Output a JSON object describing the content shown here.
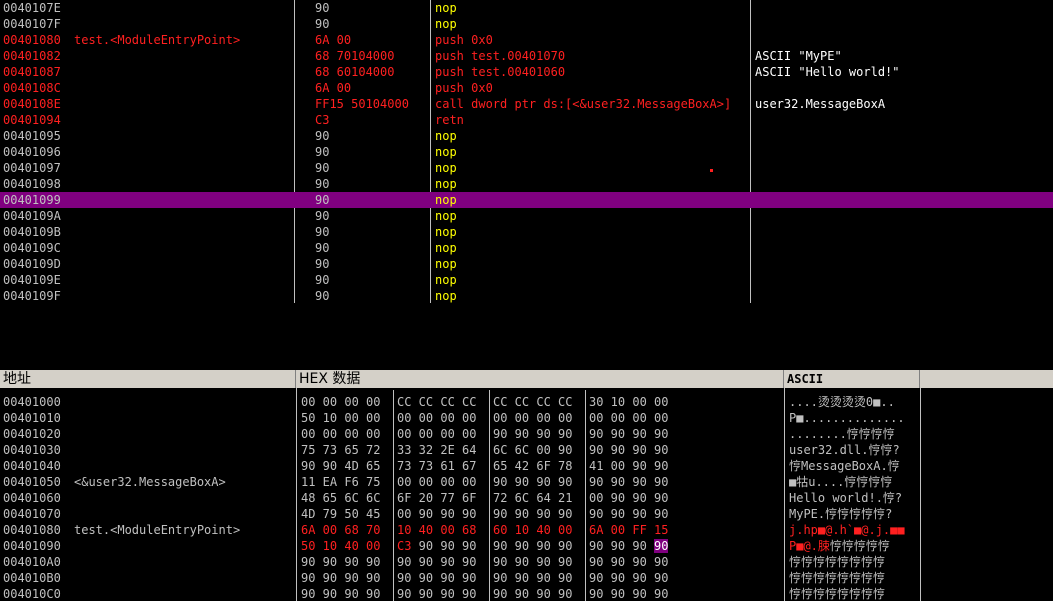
{
  "disassembly": {
    "rows": [
      {
        "addr": "0040107E",
        "label": "",
        "hex": "90",
        "asm": "nop",
        "comment": "",
        "style": "normal"
      },
      {
        "addr": "0040107F",
        "label": "",
        "hex": "90",
        "asm": "nop",
        "comment": "",
        "style": "normal"
      },
      {
        "addr": "00401080",
        "label": "test.<ModuleEntryPoint>",
        "hex": "6A 00",
        "asm": "push 0x0",
        "comment": "",
        "style": "code"
      },
      {
        "addr": "00401082",
        "label": "",
        "hex": "68 70104000",
        "asm": "push test.00401070",
        "comment": "ASCII \"MyPE\"",
        "style": "code"
      },
      {
        "addr": "00401087",
        "label": "",
        "hex": "68 60104000",
        "asm": "push test.00401060",
        "comment": "ASCII \"Hello world!\"",
        "style": "code"
      },
      {
        "addr": "0040108C",
        "label": "",
        "hex": "6A 00",
        "asm": "push 0x0",
        "comment": "",
        "style": "code"
      },
      {
        "addr": "0040108E",
        "label": "",
        "hex": "FF15 50104000",
        "asm": "call dword ptr ds:[<&user32.MessageBoxA>]",
        "comment": "user32.MessageBoxA",
        "style": "code"
      },
      {
        "addr": "00401094",
        "label": "",
        "hex": "C3",
        "asm": "retn",
        "comment": "",
        "style": "code"
      },
      {
        "addr": "00401095",
        "label": "",
        "hex": "90",
        "asm": "nop",
        "comment": "",
        "style": "normal"
      },
      {
        "addr": "00401096",
        "label": "",
        "hex": "90",
        "asm": "nop",
        "comment": "",
        "style": "normal"
      },
      {
        "addr": "00401097",
        "label": "",
        "hex": "90",
        "asm": "nop",
        "comment": "",
        "style": "normal"
      },
      {
        "addr": "00401098",
        "label": "",
        "hex": "90",
        "asm": "nop",
        "comment": "",
        "style": "normal"
      },
      {
        "addr": "00401099",
        "label": "",
        "hex": "90",
        "asm": "nop",
        "comment": "",
        "style": "selected"
      },
      {
        "addr": "0040109A",
        "label": "",
        "hex": "90",
        "asm": "nop",
        "comment": "",
        "style": "normal"
      },
      {
        "addr": "0040109B",
        "label": "",
        "hex": "90",
        "asm": "nop",
        "comment": "",
        "style": "normal"
      },
      {
        "addr": "0040109C",
        "label": "",
        "hex": "90",
        "asm": "nop",
        "comment": "",
        "style": "normal"
      },
      {
        "addr": "0040109D",
        "label": "",
        "hex": "90",
        "asm": "nop",
        "comment": "",
        "style": "normal"
      },
      {
        "addr": "0040109E",
        "label": "",
        "hex": "90",
        "asm": "nop",
        "comment": "",
        "style": "normal"
      },
      {
        "addr": "0040109F",
        "label": "",
        "hex": "90",
        "asm": "nop",
        "comment": "",
        "style": "normal"
      }
    ]
  },
  "dump": {
    "header": {
      "address": "地址",
      "hex": "HEX 数据",
      "ascii": "ASCII"
    },
    "rows": [
      {
        "addr": "00401000",
        "label": "",
        "groups": [
          "00 00 00 00",
          "CC CC CC CC",
          "CC CC CC CC",
          "30 10 00 00"
        ],
        "ascii": "....烫烫烫烫0■..",
        "style": "normal"
      },
      {
        "addr": "00401010",
        "label": "",
        "groups": [
          "50 10 00 00",
          "00 00 00 00",
          "00 00 00 00",
          "00 00 00 00"
        ],
        "ascii": "P■..............",
        "style": "normal"
      },
      {
        "addr": "00401020",
        "label": "",
        "groups": [
          "00 00 00 00",
          "00 00 00 00",
          "90 90 90 90",
          "90 90 90 90"
        ],
        "ascii": "........悙悙悙悙",
        "style": "normal"
      },
      {
        "addr": "00401030",
        "label": "",
        "groups": [
          "75 73 65 72",
          "33 32 2E 64",
          "6C 6C 00 90",
          "90 90 90 90"
        ],
        "ascii": "user32.dll.悙悙?",
        "style": "normal"
      },
      {
        "addr": "00401040",
        "label": "",
        "groups": [
          "90 90 4D 65",
          "73 73 61 67",
          "65 42 6F 78",
          "41 00 90 90"
        ],
        "ascii": "悙MessageBoxA.悙",
        "style": "normal"
      },
      {
        "addr": "00401050",
        "label": "<&user32.MessageBoxA>",
        "groups": [
          "11 EA F6 75",
          "00 00 00 00",
          "90 90 90 90",
          "90 90 90 90"
        ],
        "ascii": "■牯u....悙悙悙悙",
        "style": "normal"
      },
      {
        "addr": "00401060",
        "label": "",
        "groups": [
          "48 65 6C 6C",
          "6F 20 77 6F",
          "72 6C 64 21",
          "00 90 90 90"
        ],
        "ascii": "Hello world!.悙?",
        "style": "normal"
      },
      {
        "addr": "00401070",
        "label": "",
        "groups": [
          "4D 79 50 45",
          "00 90 90 90",
          "90 90 90 90",
          "90 90 90 90"
        ],
        "ascii": "MyPE.悙悙悙悙悙?",
        "style": "normal"
      },
      {
        "addr": "00401080",
        "label": "test.<ModuleEntryPoint>",
        "groups": [
          "6A 00 68 70",
          "10 40 00 68",
          "60 10 40 00",
          "6A 00 FF 15"
        ],
        "ascii": "j.hp■@.h`■@.j.■■",
        "style": "code"
      },
      {
        "addr": "00401090",
        "label": "",
        "groups": [
          "50 10 40 00",
          "C3 90 90 90",
          "90 90 90 90",
          "90 90 90 90"
        ],
        "ascii": "P■@.脨悙悙悙悙悙",
        "style": "partial"
      },
      {
        "addr": "004010A0",
        "label": "",
        "groups": [
          "90 90 90 90",
          "90 90 90 90",
          "90 90 90 90",
          "90 90 90 90"
        ],
        "ascii": "悙悙悙悙悙悙悙悙",
        "style": "normal"
      },
      {
        "addr": "004010B0",
        "label": "",
        "groups": [
          "90 90 90 90",
          "90 90 90 90",
          "90 90 90 90",
          "90 90 90 90"
        ],
        "ascii": "悙悙悙悙悙悙悙悙",
        "style": "normal"
      },
      {
        "addr": "004010C0",
        "label": "",
        "groups": [
          "90 90 90 90",
          "90 90 90 90",
          "90 90 90 90",
          "90 90 90 90"
        ],
        "ascii": "悙悙悙悙悙悙悙悙",
        "style": "normal"
      }
    ]
  }
}
